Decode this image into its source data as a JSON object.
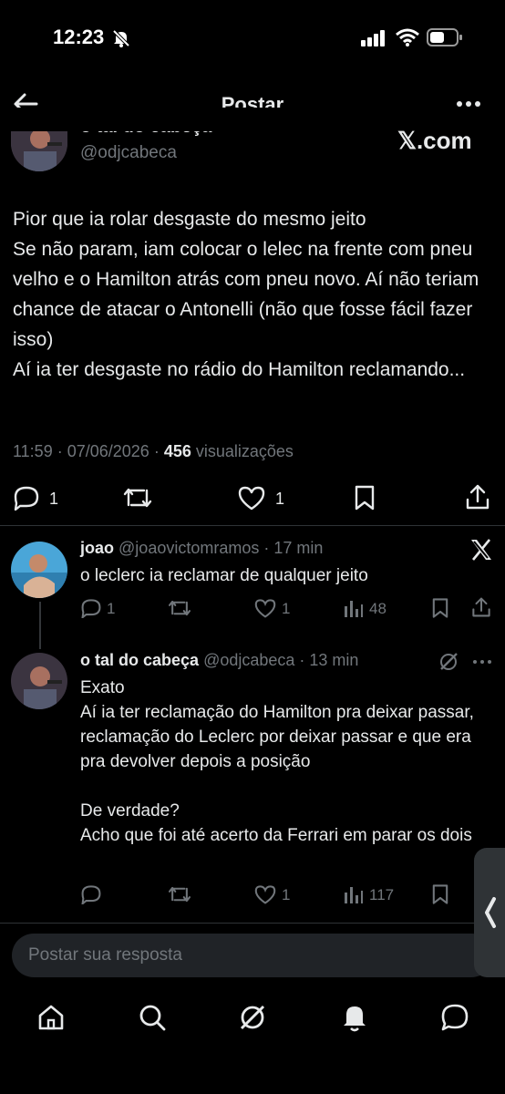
{
  "status": {
    "time": "12:23"
  },
  "topbar": {
    "title": "Postar"
  },
  "post": {
    "author_name": "o tal do cabeça",
    "author_handle": "@odjcabeca",
    "watermark": "𝕏.com",
    "text": "Pior que ia rolar desgaste do mesmo jeito\nSe não param, iam colocar o lelec na frente com pneu velho e o Hamilton atrás com pneu novo. Aí não teriam chance de atacar o Antonelli (não que fosse fácil fazer isso)\nAí ia ter desgaste no rádio do Hamilton reclamando...",
    "time": "11:59",
    "date": "07/06/2026",
    "views_count": "456",
    "views_label": "visualizações",
    "reply_count": "1",
    "like_count": "1"
  },
  "replies": [
    {
      "name": "joao",
      "handle": "@joaovictomramos",
      "age": "17 min",
      "text": "o leclerc ia reclamar de qualquer jeito",
      "reply_count": "1",
      "like_count": "1",
      "views": "48"
    },
    {
      "name": "o tal do cabeça",
      "handle": "@odjcabeca",
      "age": "13 min",
      "text": "Exato\nAí ia ter reclamação do Hamilton pra deixar passar, reclamação do Leclerc por deixar passar e que era pra devolver depois a posição\n\nDe verdade?\nAcho que foi até acerto da Ferrari em parar os dois",
      "like_count": "1",
      "views": "117"
    }
  ],
  "composer": {
    "placeholder": "Postar sua resposta"
  },
  "colors": {
    "background": "#000000",
    "text": "#e7e9ea",
    "muted": "#71767b",
    "divider": "#2f3336",
    "input_bg": "#202327"
  }
}
